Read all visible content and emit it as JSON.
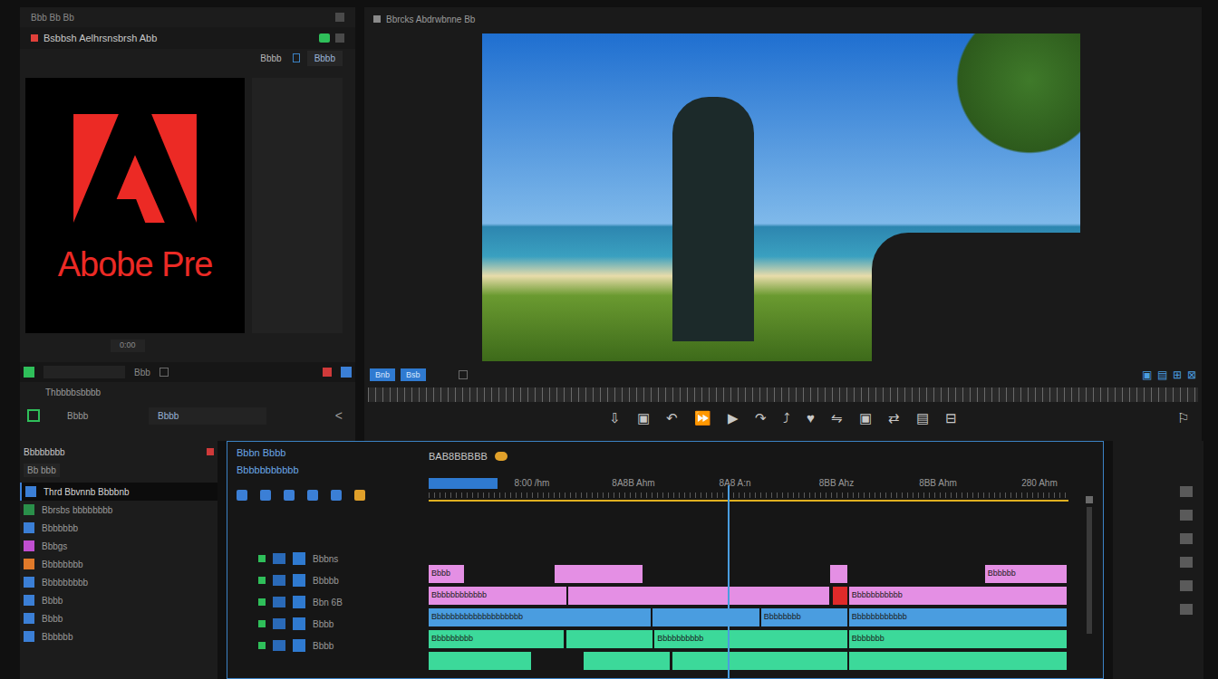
{
  "source": {
    "header": "Bbb  Bb  Bb",
    "title": "Bsbbsh Aelhrsnsbrsh Abb",
    "tab": "Bbbb",
    "side_tab": "Bbbb",
    "logo_text": "Abobe Pre",
    "timecode": "0:00",
    "field_label": "Bbb",
    "row_text": "Thbbbbsbbbb",
    "bottom_label": "Bbbb",
    "bottom_field": "Bbbb",
    "back": "<"
  },
  "program": {
    "title": "Bbrcks Abdrwbnne Bb",
    "buttons": [
      "Bnb",
      "Bsb"
    ],
    "transport": [
      "⇩",
      "▣",
      "↶",
      "⏩",
      "▶",
      "↷",
      "⤴",
      "♥",
      "⇋",
      "▣",
      "⇄",
      "▤",
      "⊟"
    ],
    "view_icons": [
      "▣",
      "▤",
      "⊞",
      "⊠"
    ],
    "end_icon": "⚐"
  },
  "project": {
    "title": "Bbbbbbbb",
    "subtitle": "Bb bbb",
    "items": [
      {
        "label": "Thrd Bbvnnb Bbbbnb",
        "color": "#3b7fd6",
        "selected": true
      },
      {
        "label": "Bbrsbs bbbbbbbb",
        "color": "#2a8f4a",
        "selected": false
      },
      {
        "label": "Bbbbbbb",
        "color": "#3b7fd6",
        "selected": false
      },
      {
        "label": "Bbbgs",
        "color": "#c04fd0",
        "selected": false
      },
      {
        "label": "Bbbbbbbb",
        "color": "#e07a2a",
        "selected": false
      },
      {
        "label": "Bbbbbbbbb",
        "color": "#3b7fd6",
        "selected": false
      },
      {
        "label": "Bbbb",
        "color": "#3b7fd6",
        "selected": false
      },
      {
        "label": "Bbbb",
        "color": "#3b7fd6",
        "selected": false
      },
      {
        "label": "Bbbbbb",
        "color": "#3b7fd6",
        "selected": false
      }
    ]
  },
  "timeline": {
    "title": "BAB8BBBBB",
    "label1": "Bbbn Bbbb",
    "label2": "Bbbbbbbbbbb",
    "ruler": [
      "8:00 /hm",
      "8A8B Ahm",
      "8A8 A:n",
      "8BB Ahz",
      "8BB Ahm",
      "280 Ahm"
    ],
    "playhead": 0.468,
    "tracks": [
      {
        "name": "Bbbns",
        "clips": [
          {
            "in": 0,
            "out": 5.5,
            "label": "Bbbb",
            "color": "#e48fe4"
          },
          {
            "in": 19.6,
            "out": 33.4,
            "label": "",
            "color": "#e48fe4"
          },
          {
            "in": 62.6,
            "out": 65.3,
            "label": "",
            "color": "#e48fe4"
          },
          {
            "in": 86.7,
            "out": 99.4,
            "label": "Bbbbbb",
            "color": "#e48fe4"
          }
        ]
      },
      {
        "name": "Bbbbb",
        "clips": [
          {
            "in": 0,
            "out": 21.4,
            "label": "Bbbbbbbbbbbb",
            "color": "#e48fe4"
          },
          {
            "in": 21.8,
            "out": 62.4,
            "label": "",
            "color": "#e48fe4"
          },
          {
            "in": 63.0,
            "out": 65.2,
            "label": "",
            "color": "#e02a2a"
          },
          {
            "in": 65.5,
            "out": 99.4,
            "label": "Bbbbbbbbbbb",
            "color": "#e48fe4"
          }
        ]
      },
      {
        "name": "Bbn 6B",
        "clips": [
          {
            "in": 0,
            "out": 34.6,
            "label": "Bbbbbbbbbbbbbbbbbbbb",
            "color": "#4a9de0"
          },
          {
            "in": 34.9,
            "out": 51.5,
            "label": "",
            "color": "#4a9de0"
          },
          {
            "in": 51.8,
            "out": 65.2,
            "label": "Bbbbbbbb",
            "color": "#4a9de0"
          },
          {
            "in": 65.5,
            "out": 99.4,
            "label": "Bbbbbbbbbbbb",
            "color": "#4a9de0"
          }
        ]
      },
      {
        "name": "Bbbb",
        "clips": [
          {
            "in": 0,
            "out": 21.1,
            "label": "Bbbbbbbbb",
            "color": "#3cd99a"
          },
          {
            "in": 21.4,
            "out": 34.9,
            "label": "",
            "color": "#3cd99a"
          },
          {
            "in": 35.2,
            "out": 65.2,
            "label": "Bbbbbbbbbb",
            "color": "#3cd99a"
          },
          {
            "in": 65.5,
            "out": 99.4,
            "label": "Bbbbbbb",
            "color": "#3cd99a"
          }
        ]
      },
      {
        "name": "Bbbb",
        "clips": [
          {
            "in": 0,
            "out": 15.9,
            "label": "",
            "color": "#3cd99a"
          },
          {
            "in": 24.1,
            "out": 37.6,
            "label": "",
            "color": "#3cd99a"
          },
          {
            "in": 38.0,
            "out": 65.2,
            "label": "",
            "color": "#3cd99a"
          },
          {
            "in": 65.5,
            "out": 99.4,
            "label": "",
            "color": "#3cd99a"
          }
        ]
      }
    ]
  }
}
